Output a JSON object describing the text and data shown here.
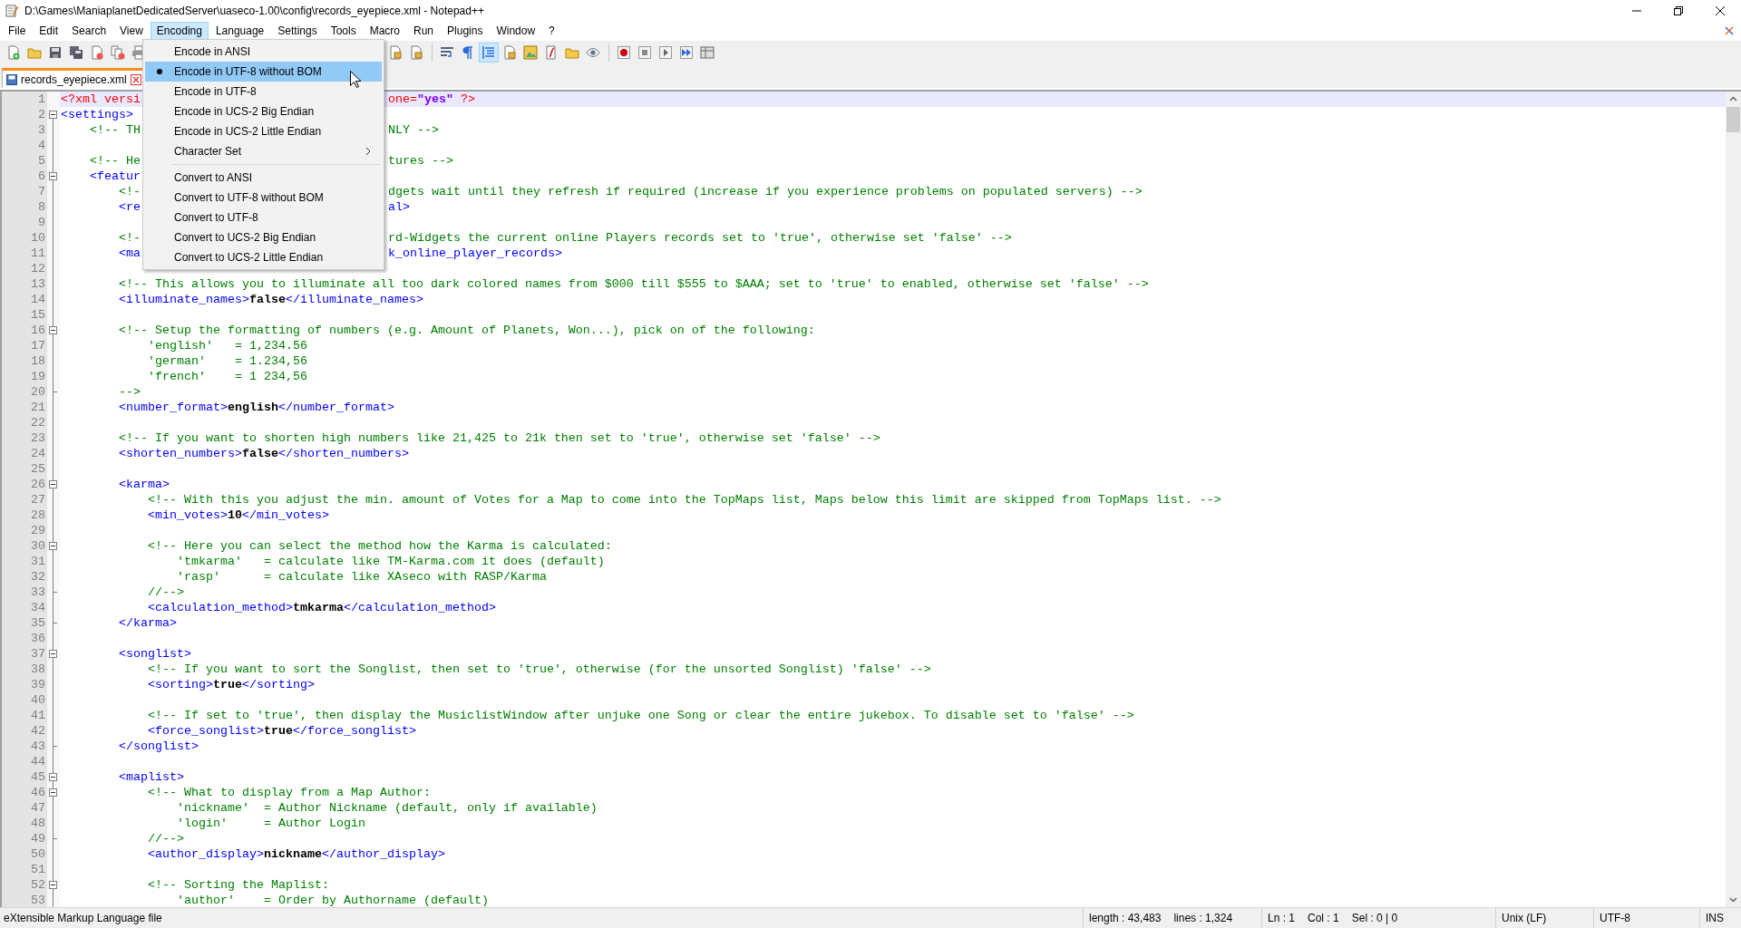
{
  "window": {
    "title": "D:\\Games\\ManiaplanetDedicatedServer\\uaseco-1.00\\config\\records_eyepiece.xml - Notepad++"
  },
  "menu_bar": [
    {
      "label": "File",
      "selected": false
    },
    {
      "label": "Edit",
      "selected": false
    },
    {
      "label": "Search",
      "selected": false
    },
    {
      "label": "View",
      "selected": false
    },
    {
      "label": "Encoding",
      "selected": true
    },
    {
      "label": "Language",
      "selected": false
    },
    {
      "label": "Settings",
      "selected": false
    },
    {
      "label": "Tools",
      "selected": false
    },
    {
      "label": "Macro",
      "selected": false
    },
    {
      "label": "Run",
      "selected": false
    },
    {
      "label": "Plugins",
      "selected": false
    },
    {
      "label": "Window",
      "selected": false
    },
    {
      "label": "?",
      "selected": false
    }
  ],
  "toolbar": [
    {
      "pressed": false
    },
    {
      "pressed": false
    },
    {
      "pressed": false
    },
    {
      "pressed": false
    },
    {
      "pressed": false
    },
    {
      "pressed": false
    },
    {
      "pressed": false
    },
    {
      "pressed": false
    },
    {
      "pressed": false
    },
    {
      "pressed": false
    },
    {
      "pressed": false
    },
    {
      "pressed": true
    },
    {
      "pressed": false
    },
    {
      "pressed": false
    },
    {
      "pressed": false
    },
    {
      "pressed": false
    },
    {
      "pressed": false
    },
    {
      "pressed": false
    },
    {
      "pressed": false
    },
    {
      "pressed": false
    },
    {
      "pressed": false
    },
    {
      "pressed": false
    }
  ],
  "dropdown": [
    {
      "kind": "item",
      "label": "Encode in ANSI",
      "selected": false,
      "checked": false
    },
    {
      "kind": "item",
      "label": "Encode in UTF-8 without BOM",
      "selected": true,
      "checked": true
    },
    {
      "kind": "item",
      "label": "Encode in UTF-8",
      "selected": false,
      "checked": false
    },
    {
      "kind": "item",
      "label": "Encode in UCS-2 Big Endian",
      "selected": false,
      "checked": false
    },
    {
      "kind": "item",
      "label": "Encode in UCS-2 Little Endian",
      "selected": false,
      "checked": false
    },
    {
      "kind": "submenu",
      "label": "Character Set",
      "selected": false,
      "checked": false
    },
    {
      "kind": "separator"
    },
    {
      "kind": "item",
      "label": "Convert to ANSI",
      "selected": false,
      "checked": false
    },
    {
      "kind": "item",
      "label": "Convert to UTF-8 without BOM",
      "selected": false,
      "checked": false
    },
    {
      "kind": "item",
      "label": "Convert to UTF-8",
      "selected": false,
      "checked": false
    },
    {
      "kind": "item",
      "label": "Convert to UCS-2 Big Endian",
      "selected": false,
      "checked": false
    },
    {
      "kind": "item",
      "label": "Convert to UCS-2 Little Endian",
      "selected": false,
      "checked": false
    }
  ],
  "tabs": [
    {
      "label": "records_eyepiece.xml",
      "selected": true
    }
  ],
  "lines": [
    {
      "number": "1",
      "current": true,
      "fold_start": false,
      "fold_end": false,
      "tokens": [
        {
          "kind": "decl",
          "text": "<?xml versi"
        }
      ],
      "after_menu": [
        {
          "kind": "decl",
          "text": "one="
        },
        {
          "kind": "attr_value",
          "text": "\"yes\""
        },
        {
          "kind": "decl",
          "text": " ?>"
        }
      ]
    },
    {
      "number": "2",
      "current": false,
      "fold_start": true,
      "fold_end": false,
      "tokens": [
        {
          "kind": "tag",
          "text": "<settings>"
        }
      ]
    },
    {
      "number": "3",
      "current": false,
      "fold_start": false,
      "fold_end": false,
      "tokens": [
        {
          "kind": "comment",
          "text": "    <!-- TH"
        }
      ],
      "after_menu": [
        {
          "kind": "comment",
          "text": "NLY -->"
        }
      ]
    },
    {
      "number": "4",
      "current": false,
      "fold_start": false,
      "fold_end": false
    },
    {
      "number": "5",
      "current": false,
      "fold_start": false,
      "fold_end": false,
      "tokens": [
        {
          "kind": "comment",
          "text": "    <!-- He"
        }
      ],
      "after_menu": [
        {
          "kind": "comment",
          "text": "tures -->"
        }
      ]
    },
    {
      "number": "6",
      "current": false,
      "fold_start": true,
      "fold_end": false,
      "tokens": [
        {
          "kind": "tag",
          "text": "    <featur"
        }
      ]
    },
    {
      "number": "7",
      "current": false,
      "fold_start": false,
      "fold_end": false,
      "tokens": [
        {
          "kind": "comment",
          "text": "        <!-"
        }
      ],
      "after_menu": [
        {
          "kind": "comment",
          "text": "dgets wait until they refresh if required (increase if you experience problems on populated servers) -->"
        }
      ]
    },
    {
      "number": "8",
      "current": false,
      "fold_start": false,
      "fold_end": false,
      "tokens": [
        {
          "kind": "tag",
          "text": "        <re"
        }
      ],
      "after_menu": [
        {
          "kind": "tag",
          "text": "al>"
        }
      ]
    },
    {
      "number": "9",
      "current": false,
      "fold_start": false,
      "fold_end": false
    },
    {
      "number": "10",
      "current": false,
      "fold_start": false,
      "fold_end": false,
      "tokens": [
        {
          "kind": "comment",
          "text": "        <!-"
        }
      ],
      "after_menu": [
        {
          "kind": "comment",
          "text": "rd-Widgets the current online Players records set to 'true', otherwise set 'false' -->"
        }
      ]
    },
    {
      "number": "11",
      "current": false,
      "fold_start": false,
      "fold_end": false,
      "tokens": [
        {
          "kind": "tag",
          "text": "        <ma"
        }
      ],
      "after_menu": [
        {
          "kind": "tag",
          "text": "k_online_player_records>"
        }
      ]
    },
    {
      "number": "12",
      "current": false,
      "fold_start": false,
      "fold_end": false
    },
    {
      "number": "13",
      "current": false,
      "fold_start": false,
      "fold_end": false,
      "tokens": [
        {
          "kind": "comment",
          "text": "        <!-- This allows you to illuminate all too dark colored names from $000 till $555 to $AAA; set to 'true' to enabled, otherwise set 'false' -->"
        }
      ]
    },
    {
      "number": "14",
      "current": false,
      "fold_start": false,
      "fold_end": false,
      "tokens": [
        {
          "kind": "tag",
          "text": "        <illuminate_names>"
        },
        {
          "kind": "value",
          "text": "false"
        },
        {
          "kind": "tag",
          "text": "</illuminate_names>"
        }
      ]
    },
    {
      "number": "15",
      "current": false,
      "fold_start": false,
      "fold_end": false
    },
    {
      "number": "16",
      "current": false,
      "fold_start": true,
      "fold_end": false,
      "tokens": [
        {
          "kind": "comment",
          "text": "        <!-- Setup the formatting of numbers (e.g. Amount of Planets, Won...), pick on of the following:"
        }
      ]
    },
    {
      "number": "17",
      "current": false,
      "fold_start": false,
      "fold_end": false,
      "tokens": [
        {
          "kind": "comment",
          "text": "            'english'   = 1,234.56"
        }
      ]
    },
    {
      "number": "18",
      "current": false,
      "fold_start": false,
      "fold_end": false,
      "tokens": [
        {
          "kind": "comment",
          "text": "            'german'    = 1.234,56"
        }
      ]
    },
    {
      "number": "19",
      "current": false,
      "fold_start": false,
      "fold_end": false,
      "tokens": [
        {
          "kind": "comment",
          "text": "            'french'    = 1 234,56"
        }
      ]
    },
    {
      "number": "20",
      "current": false,
      "fold_start": false,
      "fold_end": true,
      "tokens": [
        {
          "kind": "comment",
          "text": "        -->"
        }
      ]
    },
    {
      "number": "21",
      "current": false,
      "fold_start": false,
      "fold_end": false,
      "tokens": [
        {
          "kind": "tag",
          "text": "        <number_format>"
        },
        {
          "kind": "value",
          "text": "english"
        },
        {
          "kind": "tag",
          "text": "</number_format>"
        }
      ]
    },
    {
      "number": "22",
      "current": false,
      "fold_start": false,
      "fold_end": false
    },
    {
      "number": "23",
      "current": false,
      "fold_start": false,
      "fold_end": false,
      "tokens": [
        {
          "kind": "comment",
          "text": "        <!-- If you want to shorten high numbers like 21,425 to 21k then set to 'true', otherwise set 'false' -->"
        }
      ]
    },
    {
      "number": "24",
      "current": false,
      "fold_start": false,
      "fold_end": false,
      "tokens": [
        {
          "kind": "tag",
          "text": "        <shorten_numbers>"
        },
        {
          "kind": "value",
          "text": "false"
        },
        {
          "kind": "tag",
          "text": "</shorten_numbers>"
        }
      ]
    },
    {
      "number": "25",
      "current": false,
      "fold_start": false,
      "fold_end": false
    },
    {
      "number": "26",
      "current": false,
      "fold_start": true,
      "fold_end": false,
      "tokens": [
        {
          "kind": "tag",
          "text": "        <karma>"
        }
      ]
    },
    {
      "number": "27",
      "current": false,
      "fold_start": false,
      "fold_end": false,
      "tokens": [
        {
          "kind": "comment",
          "text": "            <!-- With this you adjust the min. amount of Votes for a Map to come into the TopMaps list, Maps below this limit are skipped from TopMaps list. -->"
        }
      ]
    },
    {
      "number": "28",
      "current": false,
      "fold_start": false,
      "fold_end": false,
      "tokens": [
        {
          "kind": "tag",
          "text": "            <min_votes>"
        },
        {
          "kind": "value",
          "text": "10"
        },
        {
          "kind": "tag",
          "text": "</min_votes>"
        }
      ]
    },
    {
      "number": "29",
      "current": false,
      "fold_start": false,
      "fold_end": false
    },
    {
      "number": "30",
      "current": false,
      "fold_start": true,
      "fold_end": false,
      "tokens": [
        {
          "kind": "comment",
          "text": "            <!-- Here you can select the method how the Karma is calculated:"
        }
      ]
    },
    {
      "number": "31",
      "current": false,
      "fold_start": false,
      "fold_end": false,
      "tokens": [
        {
          "kind": "comment",
          "text": "                'tmkarma'   = calculate like TM-Karma.com it does (default)"
        }
      ]
    },
    {
      "number": "32",
      "current": false,
      "fold_start": false,
      "fold_end": false,
      "tokens": [
        {
          "kind": "comment",
          "text": "                'rasp'      = calculate like XAseco with RASP/Karma"
        }
      ]
    },
    {
      "number": "33",
      "current": false,
      "fold_start": false,
      "fold_end": true,
      "tokens": [
        {
          "kind": "comment",
          "text": "            //-->"
        }
      ]
    },
    {
      "number": "34",
      "current": false,
      "fold_start": false,
      "fold_end": false,
      "tokens": [
        {
          "kind": "tag",
          "text": "            <calculation_method>"
        },
        {
          "kind": "value",
          "text": "tmkarma"
        },
        {
          "kind": "tag",
          "text": "</calculation_method>"
        }
      ]
    },
    {
      "number": "35",
      "current": false,
      "fold_start": false,
      "fold_end": true,
      "tokens": [
        {
          "kind": "tag",
          "text": "        </karma>"
        }
      ]
    },
    {
      "number": "36",
      "current": false,
      "fold_start": false,
      "fold_end": false
    },
    {
      "number": "37",
      "current": false,
      "fold_start": true,
      "fold_end": false,
      "tokens": [
        {
          "kind": "tag",
          "text": "        <songlist>"
        }
      ]
    },
    {
      "number": "38",
      "current": false,
      "fold_start": false,
      "fold_end": false,
      "tokens": [
        {
          "kind": "comment",
          "text": "            <!-- If you want to sort the Songlist, then set to 'true', otherwise (for the unsorted Songlist) 'false' -->"
        }
      ]
    },
    {
      "number": "39",
      "current": false,
      "fold_start": false,
      "fold_end": false,
      "tokens": [
        {
          "kind": "tag",
          "text": "            <sorting>"
        },
        {
          "kind": "value",
          "text": "true"
        },
        {
          "kind": "tag",
          "text": "</sorting>"
        }
      ]
    },
    {
      "number": "40",
      "current": false,
      "fold_start": false,
      "fold_end": false
    },
    {
      "number": "41",
      "current": false,
      "fold_start": false,
      "fold_end": false,
      "tokens": [
        {
          "kind": "comment",
          "text": "            <!-- If set to 'true', then display the MusiclistWindow after unjuke one Song or clear the entire jukebox. To disable set to 'false' -->"
        }
      ]
    },
    {
      "number": "42",
      "current": false,
      "fold_start": false,
      "fold_end": false,
      "tokens": [
        {
          "kind": "tag",
          "text": "            <force_songlist>"
        },
        {
          "kind": "value",
          "text": "true"
        },
        {
          "kind": "tag",
          "text": "</force_songlist>"
        }
      ]
    },
    {
      "number": "43",
      "current": false,
      "fold_start": false,
      "fold_end": true,
      "tokens": [
        {
          "kind": "tag",
          "text": "        </songlist>"
        }
      ]
    },
    {
      "number": "44",
      "current": false,
      "fold_start": false,
      "fold_end": false
    },
    {
      "number": "45",
      "current": false,
      "fold_start": true,
      "fold_end": false,
      "tokens": [
        {
          "kind": "tag",
          "text": "        <maplist>"
        }
      ]
    },
    {
      "number": "46",
      "current": false,
      "fold_start": true,
      "fold_end": false,
      "tokens": [
        {
          "kind": "comment",
          "text": "            <!-- What to display from a Map Author:"
        }
      ]
    },
    {
      "number": "47",
      "current": false,
      "fold_start": false,
      "fold_end": false,
      "tokens": [
        {
          "kind": "comment",
          "text": "                'nickname'  = Author Nickname (default, only if available)"
        }
      ]
    },
    {
      "number": "48",
      "current": false,
      "fold_start": false,
      "fold_end": false,
      "tokens": [
        {
          "kind": "comment",
          "text": "                'login'     = Author Login"
        }
      ]
    },
    {
      "number": "49",
      "current": false,
      "fold_start": false,
      "fold_end": true,
      "tokens": [
        {
          "kind": "comment",
          "text": "            //-->"
        }
      ]
    },
    {
      "number": "50",
      "current": false,
      "fold_start": false,
      "fold_end": false,
      "tokens": [
        {
          "kind": "tag",
          "text": "            <author_display>"
        },
        {
          "kind": "value",
          "text": "nickname"
        },
        {
          "kind": "tag",
          "text": "</author_display>"
        }
      ]
    },
    {
      "number": "51",
      "current": false,
      "fold_start": false,
      "fold_end": false
    },
    {
      "number": "52",
      "current": false,
      "fold_start": true,
      "fold_end": false,
      "tokens": [
        {
          "kind": "comment",
          "text": "            <!-- Sorting the Maplist:"
        }
      ]
    },
    {
      "number": "53",
      "current": false,
      "fold_start": false,
      "fold_end": false,
      "tokens": [
        {
          "kind": "comment",
          "text": "                'author'    = Order by Authorname (default)"
        }
      ]
    }
  ],
  "status_bar": {
    "file_type": "eXtensible Markup Language file",
    "length": "length : 43,483",
    "lines": "lines : 1,324",
    "ln": "Ln : 1",
    "col": "Col : 1",
    "sel": "Sel : 0 | 0",
    "eol": "Unix (LF)",
    "encoding": "UTF-8",
    "mode": "INS"
  }
}
